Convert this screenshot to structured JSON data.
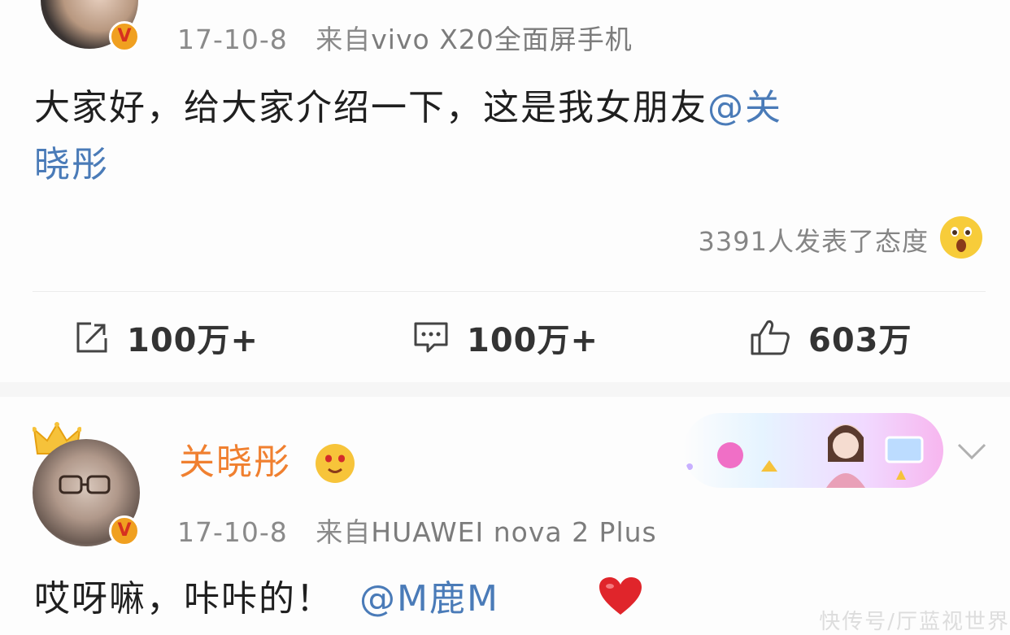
{
  "post1": {
    "date": "17-10-8",
    "source_prefix": "来自",
    "device": "vivo X20全面屏手机",
    "text_part1": "大家好，给大家介绍一下，这是我女朋友",
    "mention_line1": "@关",
    "mention_line2": "晓彤",
    "reactions_text": "3391人发表了态度",
    "repost_count": "100万+",
    "comment_count": "100万+",
    "like_count": "603万"
  },
  "post2": {
    "username": "关晓彤",
    "date": "17-10-8",
    "source_prefix": "来自",
    "device": "HUAWEI nova 2 Plus",
    "text": "哎呀嘛，咔咔的！",
    "mention": "@M鹿M"
  },
  "icons": {
    "verified": "verified-badge-icon",
    "surprised_emoji": "surprised-emoji-icon",
    "repost": "repost-icon",
    "comment": "comment-icon",
    "like": "thumbs-up-icon",
    "crown": "crown-icon",
    "vip": "vip-badge-icon",
    "chevron": "chevron-down-icon",
    "heart": "heart-icon"
  },
  "colors": {
    "mention": "#4a7bb8",
    "username": "#f08030",
    "verified": "#f0a020"
  },
  "watermark": "快传号/厅蓝视世界"
}
